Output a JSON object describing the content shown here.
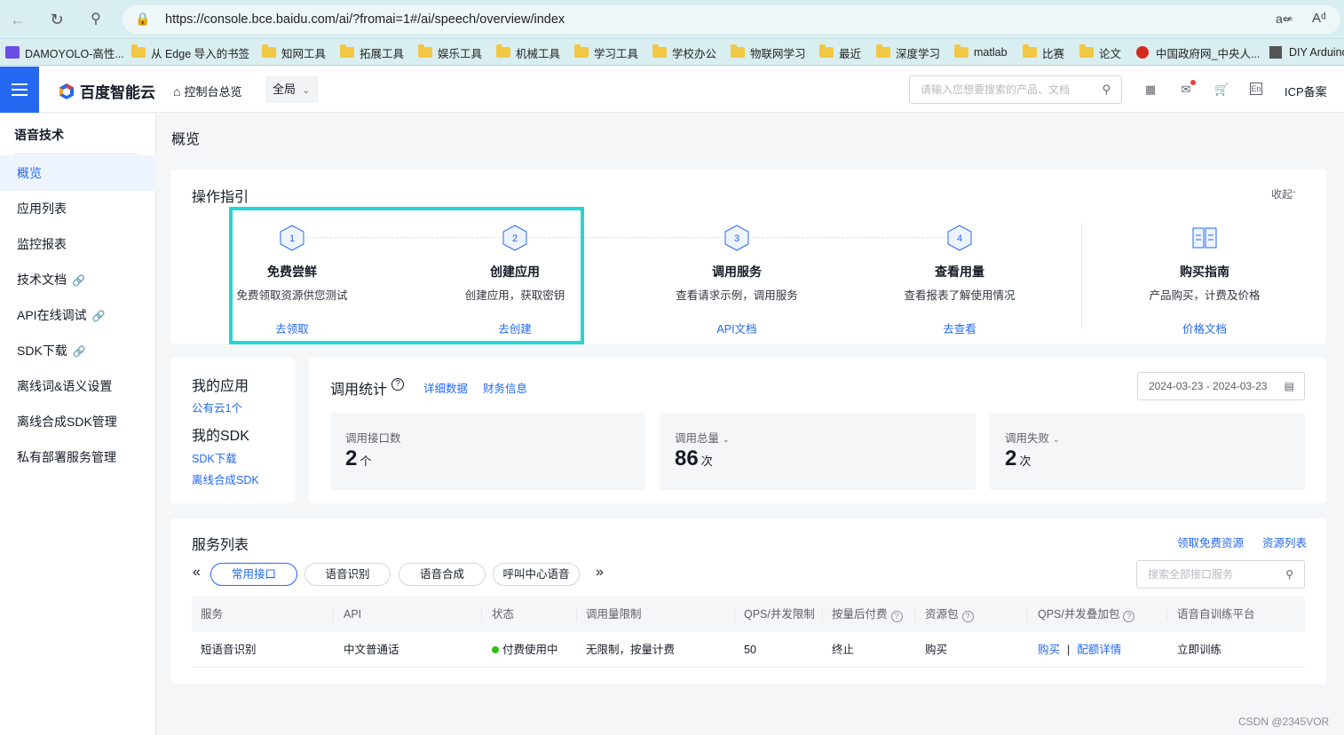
{
  "browser": {
    "url": "https://console.bce.baidu.com/ai/?fromai=1#/ai/speech/overview/index",
    "bookmarks": [
      "DAMOYOLO-高性...",
      "从 Edge 导入的书签",
      "知网工具",
      "拓展工具",
      "娱乐工具",
      "机械工具",
      "学习工具",
      "学校办公",
      "物联网学习",
      "最近",
      "深度学习",
      "matlab",
      "比赛",
      "论文",
      "中国政府网_中央人...",
      "DIY Arduino"
    ]
  },
  "header": {
    "logo": "百度智能云",
    "home": "控制台总览",
    "region": "全局",
    "search_placeholder": "请输入您想要搜索的产品、文档",
    "icp": "ICP备案"
  },
  "sidebar": {
    "title": "语音技术",
    "items": [
      {
        "label": "概览",
        "active": true
      },
      {
        "label": "应用列表"
      },
      {
        "label": "监控报表"
      },
      {
        "label": "技术文档"
      },
      {
        "label": "API在线调试"
      },
      {
        "label": "SDK下载"
      },
      {
        "label": "离线词&语义设置"
      },
      {
        "label": "离线合成SDK管理"
      },
      {
        "label": "私有部署服务管理"
      }
    ]
  },
  "page": {
    "title": "概览"
  },
  "guide": {
    "title": "操作指引",
    "collapse": "收起",
    "steps": [
      {
        "num": "1",
        "name": "免费尝鲜",
        "desc": "免费领取资源供您测试",
        "link": "去领取"
      },
      {
        "num": "2",
        "name": "创建应用",
        "desc": "创建应用，获取密钥",
        "link": "去创建"
      },
      {
        "num": "3",
        "name": "调用服务",
        "desc": "查看请求示例，调用服务",
        "link": "API文档"
      },
      {
        "num": "4",
        "name": "查看用量",
        "desc": "查看报表了解使用情况",
        "link": "去查看"
      }
    ],
    "buy": {
      "name": "购买指南",
      "desc": "产品购买，计费及价格",
      "link": "价格文档"
    }
  },
  "myapps": {
    "title": "我的应用",
    "public_cloud": "公有云1个",
    "sdk_title": "我的SDK",
    "sdk_download": "SDK下载",
    "offline_sdk": "离线合成SDK"
  },
  "stats": {
    "title": "调用统计",
    "detail_link": "详细数据",
    "finance_link": "财务信息",
    "date_range": "2024-03-23 - 2024-03-23",
    "boxes": [
      {
        "label": "调用接口数",
        "value": "2",
        "unit": "个"
      },
      {
        "label": "调用总量",
        "value": "86",
        "unit": "次"
      },
      {
        "label": "调用失败",
        "value": "2",
        "unit": "次"
      }
    ]
  },
  "services": {
    "title": "服务列表",
    "free_link": "领取免费资源",
    "resource_link": "资源列表",
    "tabs": [
      "常用接口",
      "语音识别",
      "语音合成",
      "呼叫中心语音"
    ],
    "search_placeholder": "搜索全部接口服务",
    "columns": [
      "服务",
      "API",
      "状态",
      "调用量限制",
      "QPS/并发限制",
      "按量后付费",
      "资源包",
      "QPS/并发叠加包",
      "语音自训练平台"
    ],
    "rows": [
      {
        "service": "短语音识别",
        "api": "中文普通话",
        "status": "付费使用中",
        "limit": "无限制，按量计费",
        "qps": "50",
        "postpaid": "终止",
        "package": "购买",
        "qps_buy": "购买",
        "qps_detail": "配额详情",
        "train": "立即训练"
      }
    ]
  },
  "watermark": "CSDN @2345VOR",
  "colors": {
    "accent": "#2468f2",
    "highlight": "#22d6d6",
    "status_green": "#30bf13"
  }
}
